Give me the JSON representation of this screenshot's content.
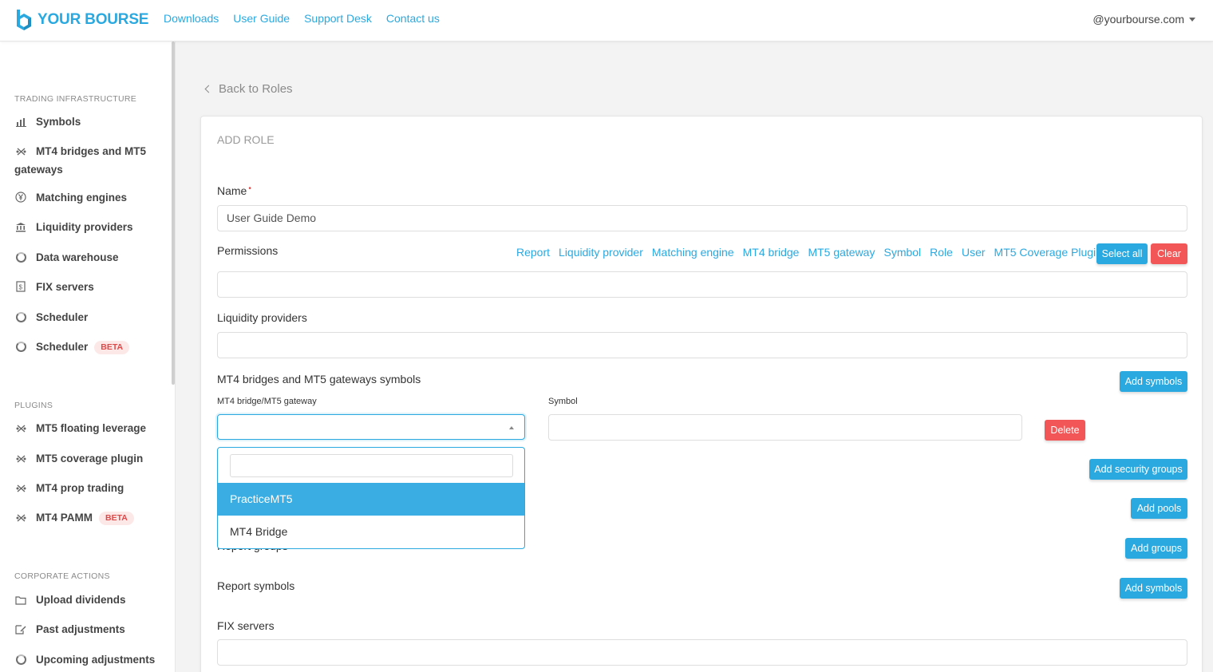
{
  "header": {
    "brand": "YOUR BOURSE",
    "nav": [
      "Downloads",
      "User Guide",
      "Support Desk",
      "Contact us"
    ],
    "user": "@yourbourse.com"
  },
  "sidebar": {
    "sections": [
      {
        "title": "TRADING INFRASTRUCTURE"
      },
      {
        "title": "PLUGINS"
      },
      {
        "title": "CORPORATE ACTIONS"
      }
    ],
    "items": [
      {
        "label": "Symbols",
        "icon": "bar-chart-icon"
      },
      {
        "label": "MT4 bridges and MT5 gateways",
        "icon": "bridge-icon"
      },
      {
        "label": "Matching engines",
        "icon": "yen-icon"
      },
      {
        "label": "Liquidity providers",
        "icon": "bank-icon"
      },
      {
        "label": "Data warehouse",
        "icon": "ring-icon"
      },
      {
        "label": "FIX servers",
        "icon": "document-icon"
      },
      {
        "label": "Scheduler",
        "icon": "ring-icon"
      },
      {
        "label": "Scheduler",
        "icon": "ring-icon",
        "badge": "BETA"
      },
      {
        "label": "MT5 floating leverage",
        "icon": "bridge-icon"
      },
      {
        "label": "MT5 coverage plugin",
        "icon": "bridge-icon"
      },
      {
        "label": "MT4 prop trading",
        "icon": "bridge-icon"
      },
      {
        "label": "MT4 PAMM",
        "icon": "bridge-icon",
        "badge": "BETA"
      },
      {
        "label": "Upload dividends",
        "icon": "folder-icon"
      },
      {
        "label": "Past adjustments",
        "icon": "edit-icon"
      },
      {
        "label": "Upcoming adjustments",
        "icon": "ring-icon"
      }
    ]
  },
  "main": {
    "back_label": "Back to Roles",
    "card_title": "ADD ROLE",
    "name_label": "Name",
    "name_required": "•",
    "name_value": "User Guide Demo",
    "permissions_label": "Permissions",
    "permission_links": [
      "Report",
      "Liquidity provider",
      "Matching engine",
      "MT4 bridge",
      "MT5 gateway",
      "Symbol",
      "Role",
      "User",
      "MT5 Coverage Plugin"
    ],
    "select_all": "Select all",
    "clear": "Clear",
    "lp_label": "Liquidity providers",
    "bridges_symbols_label": "MT4 bridges and MT5 gateways symbols",
    "add_symbols": "Add symbols",
    "bridge_gateway_label": "MT4 bridge/MT5 gateway",
    "symbol_label": "Symbol",
    "delete": "Delete",
    "add_security_groups": "Add security groups",
    "add_pools": "Add pools",
    "report_groups_label": "Report groups",
    "add_groups": "Add groups",
    "report_symbols_label": "Report symbols",
    "add_symbols_2": "Add symbols",
    "fix_servers_label": "FIX servers",
    "dropdown_options": [
      "PracticeMT5",
      "MT4 Bridge"
    ]
  },
  "colors": {
    "accent": "#2aa9e0",
    "danger": "#f25656"
  }
}
